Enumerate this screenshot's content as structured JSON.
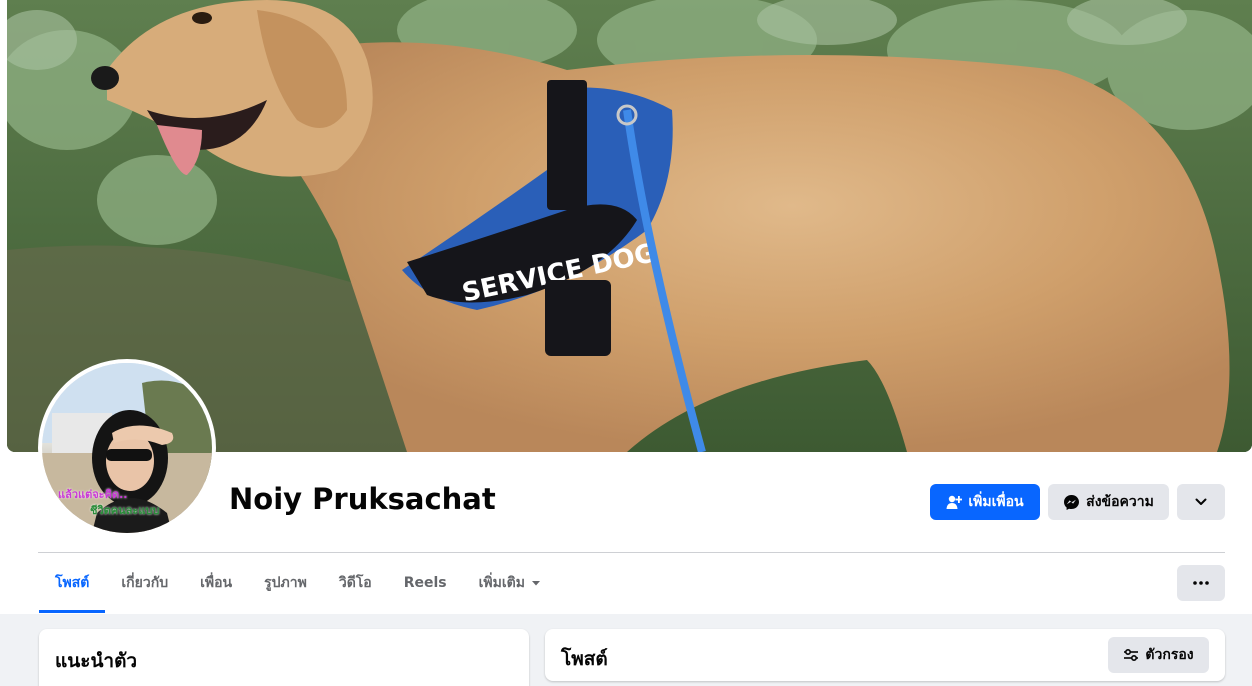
{
  "profile": {
    "name": "Noiy Pruksachat",
    "avatar_caption_line1": "แล้วแต่จะคิด..",
    "avatar_caption_line2": "ชีวิตคนละแบบ"
  },
  "cover": {
    "harness_text": "SERVICE DOG"
  },
  "actions": {
    "add_friend_label": "เพิ่มเพื่อน",
    "message_label": "ส่งข้อความ",
    "more_icon": "chevron-down-icon"
  },
  "tabs": [
    {
      "label": "โพสต์",
      "active": true
    },
    {
      "label": "เกี่ยวกับ",
      "active": false
    },
    {
      "label": "เพื่อน",
      "active": false
    },
    {
      "label": "รูปภาพ",
      "active": false
    },
    {
      "label": "วิดีโอ",
      "active": false
    },
    {
      "label": "Reels",
      "active": false
    },
    {
      "label": "เพิ่มเติม",
      "active": false
    }
  ],
  "intro_card": {
    "title": "แนะนำตัว"
  },
  "posts_card": {
    "title": "โพสต์",
    "filter_label": "ตัวกรอง"
  },
  "colors": {
    "accent": "#0866ff",
    "secondary_button": "#e4e6eb",
    "page_background": "#f0f2f5",
    "text_primary": "#050505",
    "text_secondary": "#65676b"
  }
}
